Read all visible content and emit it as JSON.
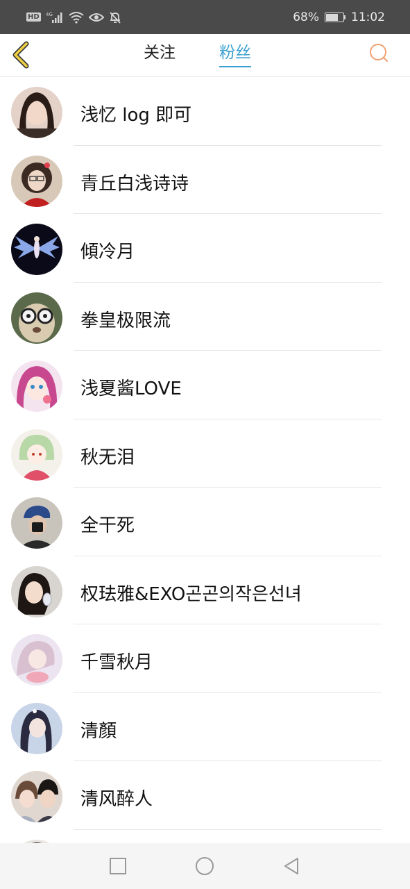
{
  "status_bar": {
    "hd": "HD",
    "network": "4G",
    "battery_percent": "68%",
    "battery_level": 0.68,
    "time": "11:02",
    "icons": [
      "signal-icon",
      "wifi-icon",
      "eye-icon",
      "mute-bell-icon",
      "battery-icon"
    ]
  },
  "header": {
    "back_icon": "chevron-left-icon",
    "tabs": [
      {
        "label": "关注",
        "active": false
      },
      {
        "label": "粉丝",
        "active": true
      }
    ],
    "search_icon": "search-icon"
  },
  "colors": {
    "accent": "#3aa0d0",
    "back_arrow": "#f0d040",
    "search": "#f0a070",
    "status_bar_bg": "#4a4a4a"
  },
  "fans": [
    {
      "name": "浅忆 log 即可"
    },
    {
      "name": "青丘白浅诗诗"
    },
    {
      "name": "傾冷月"
    },
    {
      "name": "拳皇极限流"
    },
    {
      "name": "浅夏酱LOVE"
    },
    {
      "name": "秋无泪"
    },
    {
      "name": "全干死"
    },
    {
      "name": "权珐雅&EXO곤곤의작은선녀"
    },
    {
      "name": "千雪秋月"
    },
    {
      "name": "清顏"
    },
    {
      "name": "清风醉人"
    },
    {
      "name": ""
    }
  ],
  "nav_bar": {
    "icons": [
      "recent-apps-icon",
      "home-icon",
      "back-icon"
    ]
  }
}
